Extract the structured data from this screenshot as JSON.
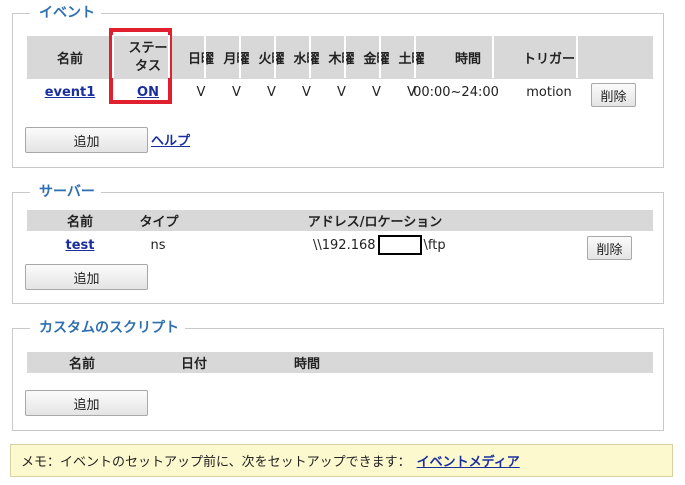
{
  "events": {
    "legend": "イベント",
    "columns": [
      "名前",
      "ステー\nタス",
      "日曜",
      "月曜",
      "火曜",
      "水曜",
      "木曜",
      "金曜",
      "土曜",
      "時間",
      "トリガー",
      ""
    ],
    "row": {
      "name": "event1",
      "status": "ON",
      "days": [
        "V",
        "V",
        "V",
        "V",
        "V",
        "V",
        "V"
      ],
      "time": "00:00~24:00",
      "trigger": "motion",
      "delete": "削除"
    },
    "add": "追加",
    "help": "ヘルプ"
  },
  "servers": {
    "legend": "サーバー",
    "columns": [
      "名前",
      "タイプ",
      "アドレス/ロケーション",
      ""
    ],
    "row": {
      "name": "test",
      "type": "ns",
      "address_prefix": "\\\\192.168",
      "address_suffix": "\\ftp",
      "delete": "削除"
    },
    "add": "追加"
  },
  "scripts": {
    "legend": "カスタムのスクリプト",
    "columns": [
      "名前",
      "日付",
      "時間",
      "",
      ""
    ],
    "add": "追加"
  },
  "memo": {
    "text": "メモ：イベントのセットアップ前に、次をセットアップできます：",
    "link": "イベントメディア"
  }
}
